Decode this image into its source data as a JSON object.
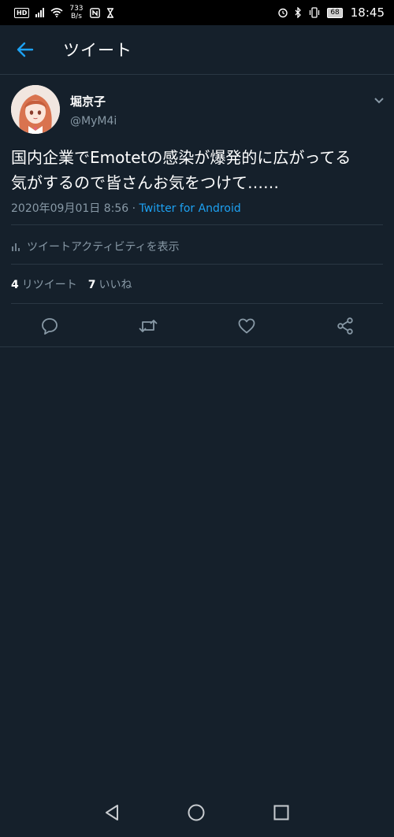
{
  "status_bar": {
    "hd": "HD",
    "speed_value": "733",
    "speed_unit": "B/s",
    "battery": "68",
    "time": "18:45"
  },
  "header": {
    "title": "ツイート",
    "back_icon": "arrow-left-icon"
  },
  "tweet": {
    "author_name": "堀京子",
    "author_handle": "@MyM4i",
    "text_line1": "国内企業でEmotetの感染が爆発的に広がってる",
    "text_line2": "気がするので皆さんお気をつけて……",
    "timestamp": "2020年09月01日 8:56",
    "separator": " · ",
    "source": "Twitter for Android",
    "activity_label": "ツイートアクティビティを表示",
    "retweet_count": "4",
    "retweet_label": "リツイート",
    "like_count": "7",
    "like_label": "いいね"
  },
  "actions": [
    "reply-icon",
    "retweet-icon",
    "like-icon",
    "share-icon"
  ],
  "colors": {
    "background": "#15202b",
    "accent": "#1da1f2",
    "secondary_text": "#8899a6",
    "divider": "#2a3743"
  }
}
